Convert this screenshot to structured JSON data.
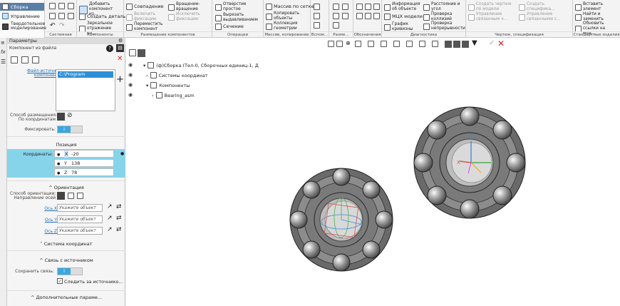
{
  "ribbon": {
    "modes": [
      "Сборка",
      "Управление",
      "Твердотельное моделирование"
    ],
    "groups": [
      "Системная",
      "Компоненты",
      "Размещение компонентов",
      "Операции",
      "Массив, копирование",
      "Вспом...",
      "Разме...",
      "Обозначения",
      "Диагностика",
      "Чертеж, спецификация",
      "Стандартные изделия"
    ],
    "components": {
      "add": "Добавить компонент из...",
      "create_part": "Создать деталь",
      "mirror": "Зеркальное отражение ко..."
    },
    "placement": {
      "coincide": "Совпадение",
      "rotate": "Вращение-вращение",
      "include": "Включить фиксацию",
      "exclude": "Исключить фиксацию",
      "move": "Переместить компонент"
    },
    "ops": {
      "hole": "Отверстие простое",
      "cut": "Вырезать выдавливанием",
      "section": "Сечение"
    },
    "array": {
      "grid": "Массив по сетке",
      "copy": "Копировать объекты",
      "collection": "Коллекция геометрии"
    },
    "diag": {
      "info": "Информация об объекте",
      "mcc": "МЦХ модели",
      "curvature": "График кривизны",
      "distance": "Расстояние и угол",
      "collisions": "Проверка коллизий",
      "continuity": "Проверка непрерывности"
    },
    "drawing": {
      "create_drawing": "Создать чертеж по модели",
      "create_spec": "Создать специфика...",
      "manage_links": "Управление связанным ч...",
      "manage_links2": "Управление связанными с..."
    },
    "std": {
      "insert": "Вставить элемент",
      "find": "Найти и заменить",
      "update": "Обновить ссылки на мод..."
    }
  },
  "panel": {
    "title": "Параметры",
    "subtitle": "Компонент из файла",
    "file_label": "Файл-источник компонента",
    "file_path": "C:\\Program Files\\ASCON...",
    "placement_label": "Способ размещения:",
    "placement_value": "По координатам",
    "fix_label": "Фиксировать:",
    "fix_value": "I",
    "position": "Позиция",
    "coords_label": "Координаты:",
    "coords": [
      {
        "axis": "X",
        "value": "-20"
      },
      {
        "axis": "Y",
        "value": "138"
      },
      {
        "axis": "Z",
        "value": "78"
      }
    ],
    "orientation": "Ориентация",
    "orient_label": "Способ ориентации:",
    "orient_dir": "Направление осей",
    "axes": [
      {
        "label": "Ось X",
        "placeholder": "Укажите объект"
      },
      {
        "label": "Ось Y",
        "placeholder": "Укажите объект"
      },
      {
        "label": "Ось Z",
        "placeholder": "Укажите объект"
      }
    ],
    "coord_system": "Система координат",
    "link_source": "Связь с источником",
    "keep_link_label": "Сохранить связь:",
    "keep_link_value": "I",
    "follow_source": "Следить за источнико...",
    "extra": "Дополнительные параме..."
  },
  "tree": {
    "root": "(ф)Сборка (Тел-0, Сборочных единиц-1, Д",
    "cs": "Системы координат",
    "components": "Компоненты",
    "bearing": "Bearing_asm"
  }
}
